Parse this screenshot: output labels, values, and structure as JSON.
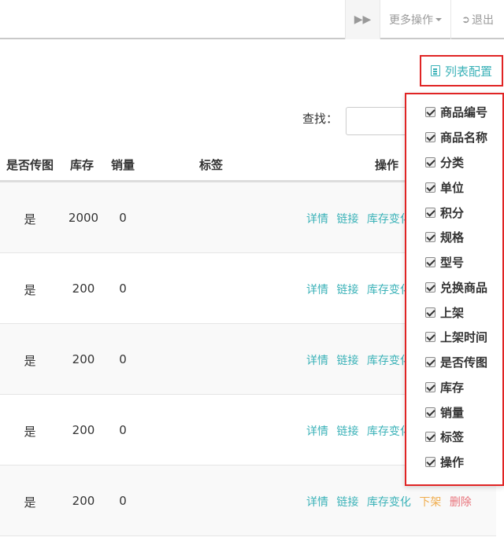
{
  "topbar": {
    "more_label": "更多操作",
    "exit_label": "退出"
  },
  "toolbar": {
    "list_config_label": "列表配置",
    "search_label": "查找："
  },
  "table": {
    "headers": [
      "是否传图",
      "库存",
      "销量",
      "标签",
      "操作"
    ],
    "rows": [
      {
        "upload": "是",
        "stock": "2000",
        "sales": "0",
        "ops": [
          "详情",
          "链接",
          "库存变化"
        ]
      },
      {
        "upload": "是",
        "stock": "200",
        "sales": "0",
        "ops": [
          "详情",
          "链接",
          "库存变化"
        ]
      },
      {
        "upload": "是",
        "stock": "200",
        "sales": "0",
        "ops": [
          "详情",
          "链接",
          "库存变化"
        ]
      },
      {
        "upload": "是",
        "stock": "200",
        "sales": "0",
        "ops": [
          "详情",
          "链接",
          "库存变化"
        ]
      },
      {
        "upload": "是",
        "stock": "200",
        "sales": "0",
        "ops": [
          "详情",
          "链接",
          "库存变化",
          "下架",
          "删除"
        ]
      }
    ]
  },
  "column_config": {
    "items": [
      {
        "label": "商品编号",
        "checked": true
      },
      {
        "label": "商品名称",
        "checked": true
      },
      {
        "label": "分类",
        "checked": true
      },
      {
        "label": "单位",
        "checked": true
      },
      {
        "label": "积分",
        "checked": true
      },
      {
        "label": "规格",
        "checked": true
      },
      {
        "label": "型号",
        "checked": true
      },
      {
        "label": "兑换商品",
        "checked": true
      },
      {
        "label": "上架",
        "checked": true
      },
      {
        "label": "上架时间",
        "checked": true
      },
      {
        "label": "是否传图",
        "checked": true
      },
      {
        "label": "库存",
        "checked": true
      },
      {
        "label": "销量",
        "checked": true
      },
      {
        "label": "标签",
        "checked": true
      },
      {
        "label": "操作",
        "checked": true
      }
    ]
  },
  "colors": {
    "accent": "#3bb2b8",
    "highlight_border": "#e02424",
    "offshelf": "#f0ad4e",
    "delete": "#e8727a"
  }
}
